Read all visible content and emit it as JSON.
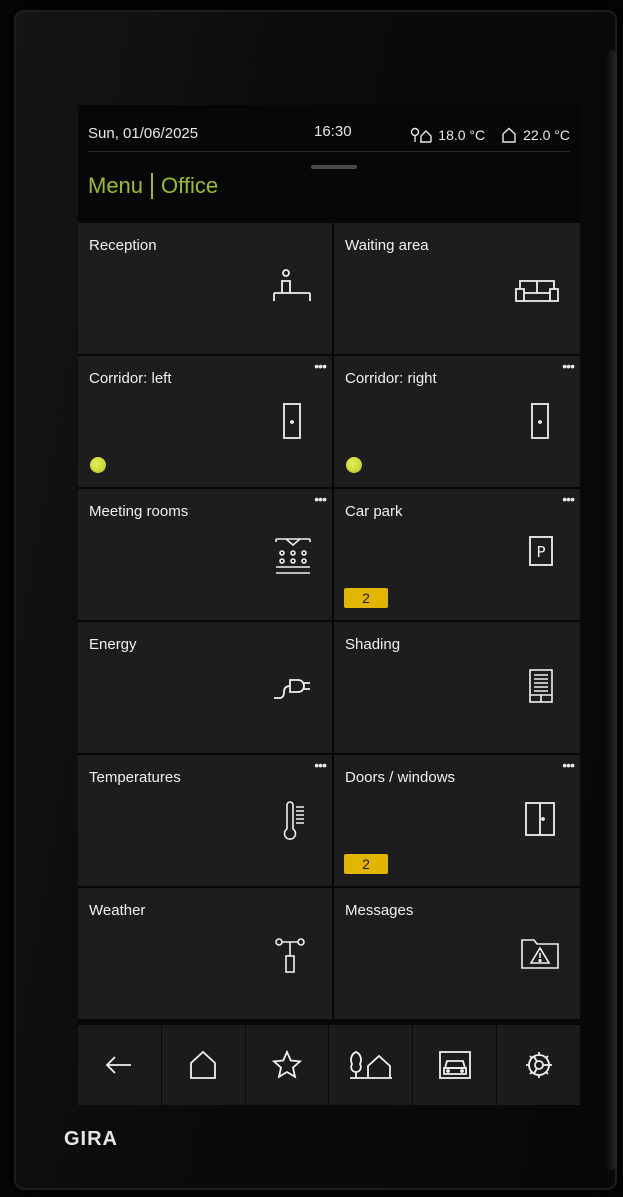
{
  "status": {
    "date": "Sun, 01/06/2025",
    "time": "16:30",
    "outdoor_temp": "18.0 °C",
    "indoor_temp": "22.0 °C",
    "outdoor_icon": "outdoor-temperature-icon",
    "indoor_icon": "house-icon"
  },
  "breadcrumb": {
    "menu": "Menu",
    "current": "Office"
  },
  "accent_color": "#9bbc2c",
  "badge_color": "#e2b600",
  "tiles": [
    {
      "name": "Reception",
      "icon": "reception-desk-icon",
      "more": ""
    },
    {
      "name": "Waiting area",
      "icon": "sofa-icon",
      "more": ""
    },
    {
      "name": "Corridor: left",
      "icon": "door-icon",
      "more": "•••",
      "status": "active"
    },
    {
      "name": "Corridor: right",
      "icon": "door-icon",
      "more": "•••",
      "status": "active"
    },
    {
      "name": "Meeting rooms",
      "icon": "meeting-room-icon",
      "more": "•••"
    },
    {
      "name": "Car park",
      "icon": "parking-icon",
      "more": "•••",
      "badge": "2"
    },
    {
      "name": "Energy",
      "icon": "plug-icon",
      "more": ""
    },
    {
      "name": "Shading",
      "icon": "blinds-icon",
      "more": ""
    },
    {
      "name": "Temperatures",
      "icon": "thermometer-icon",
      "more": "•••"
    },
    {
      "name": "Doors / windows",
      "icon": "window-icon",
      "more": "•••",
      "badge": "2"
    },
    {
      "name": "Weather",
      "icon": "weather-station-icon",
      "more": ""
    },
    {
      "name": "Messages",
      "icon": "warning-folder-icon",
      "more": ""
    }
  ],
  "nav": [
    "back-arrow-icon",
    "home-icon",
    "favorites-star-icon",
    "outdoor-house-icon",
    "garage-icon",
    "settings-gear-icon"
  ],
  "brand": "GIRA"
}
